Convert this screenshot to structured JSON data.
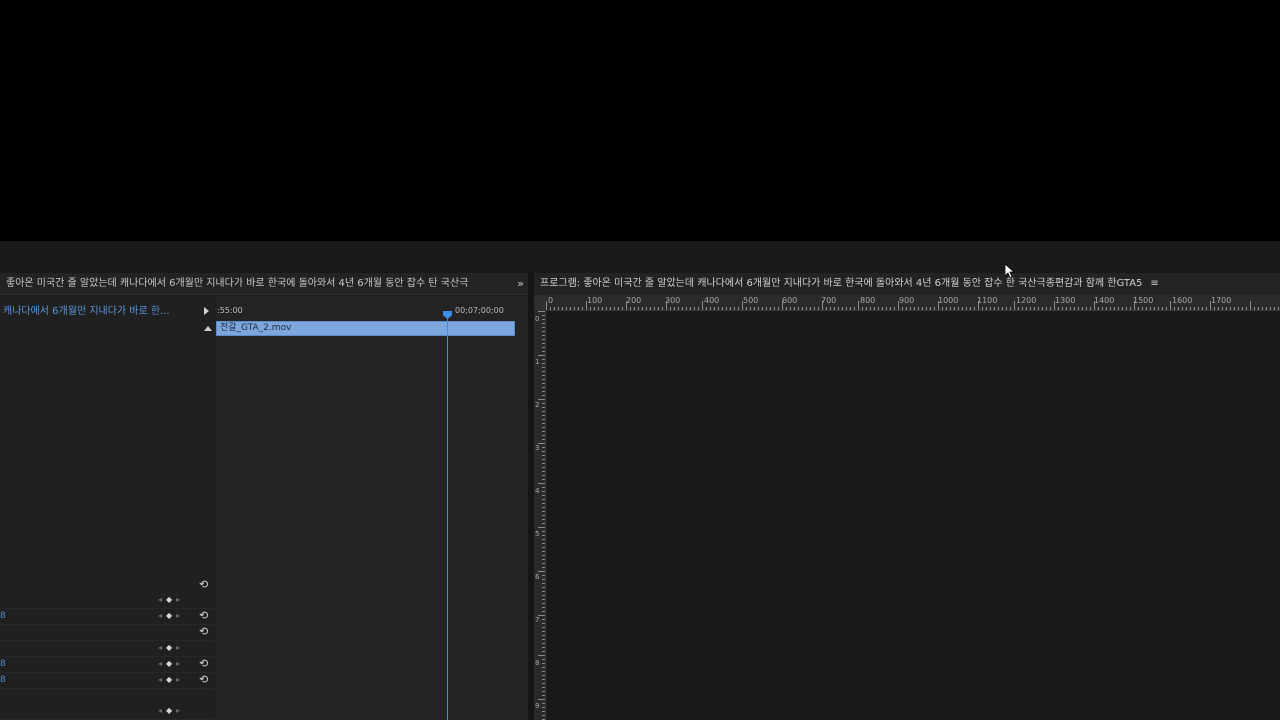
{
  "effect_controls": {
    "header_title": "좋아온 미국간 줄 알았는데 캐나다에서 6개월만 지내다가 바로 한국에 돌아와서 4년 6개월 동안 잡수 탄 국산극",
    "more_label": "»",
    "sequence_label": "캐나다에서 6개월만 지내다가 바로 한...",
    "rows": [
      {
        "value": ""
      },
      {
        "value": "8"
      },
      {
        "value": ""
      },
      {
        "value": "8"
      },
      {
        "value": "8"
      },
      {
        "value": ""
      }
    ],
    "timeline": {
      "start_time": ":55:00",
      "end_time": "00;07;00;00",
      "clip_name": "전갈_GTA_2.mov"
    }
  },
  "program_monitor": {
    "header_title": "프로그램: 좋아온 미국간 줄 알았는데 캐나다에서 6개월만 지내다가 바로 한국에 돌아와서 4년 6개월 동안 잡수 한 국산극종편감과 함께 한GTA5",
    "menu_icon": "≡",
    "ruler_labels": [
      "0",
      "100",
      "200",
      "300",
      "400",
      "500",
      "600",
      "700",
      "800",
      "900",
      "1000",
      "1100",
      "1200",
      "1300",
      "1400",
      "1500",
      "1600",
      "1700"
    ],
    "vruler_labels": [
      "0",
      "1",
      "2",
      "3",
      "4",
      "5",
      "6",
      "7",
      "8",
      "9"
    ]
  },
  "colors": {
    "accent": "#3f8ce8",
    "clip": "#7ca6dc",
    "panel": "#1d1d1d"
  }
}
